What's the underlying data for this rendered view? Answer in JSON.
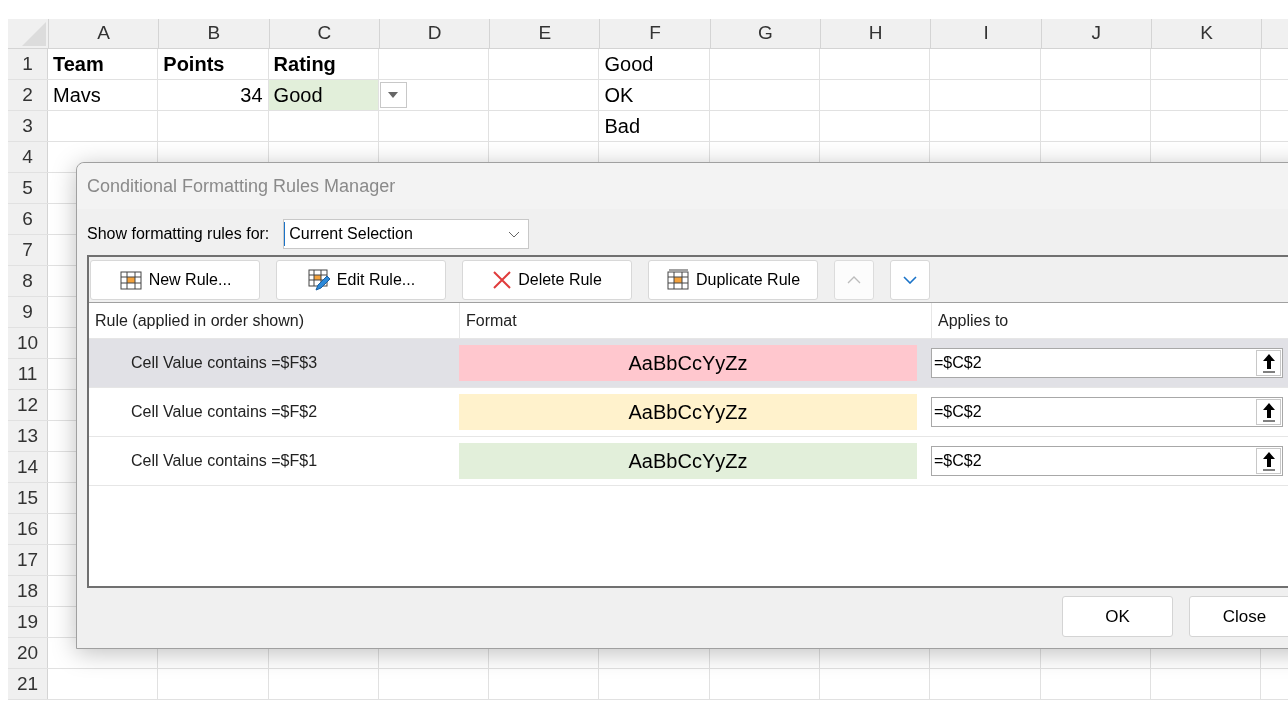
{
  "sheet": {
    "columns": [
      "A",
      "B",
      "C",
      "D",
      "E",
      "F",
      "G",
      "H",
      "I",
      "J",
      "K"
    ],
    "rows": [
      {
        "number": "1",
        "cells": [
          {
            "text": "Team",
            "bold": true,
            "kind": "text"
          },
          {
            "text": "Points",
            "bold": true,
            "kind": "text"
          },
          {
            "text": "Rating",
            "bold": true,
            "kind": "text"
          },
          null,
          null,
          {
            "text": "Good",
            "bold": false,
            "kind": "text"
          }
        ]
      },
      {
        "number": "2",
        "cells": [
          {
            "text": "Mavs",
            "bold": false,
            "kind": "text"
          },
          {
            "text": "34",
            "bold": false,
            "kind": "number"
          },
          {
            "text": "Good",
            "bold": false,
            "kind": "text",
            "color": "#e2efda",
            "dropdown": true
          },
          null,
          null,
          {
            "text": "OK",
            "bold": false,
            "kind": "text"
          }
        ]
      },
      {
        "number": "3",
        "cells": [
          null,
          null,
          null,
          null,
          null,
          {
            "text": "Bad",
            "bold": false,
            "kind": "text"
          }
        ]
      },
      {
        "number": "4"
      },
      {
        "number": "5"
      },
      {
        "number": "6"
      },
      {
        "number": "7"
      },
      {
        "number": "8"
      },
      {
        "number": "9"
      },
      {
        "number": "10"
      },
      {
        "number": "11"
      },
      {
        "number": "12"
      },
      {
        "number": "13"
      },
      {
        "number": "14"
      },
      {
        "number": "15"
      },
      {
        "number": "16"
      },
      {
        "number": "17"
      },
      {
        "number": "18"
      },
      {
        "number": "19"
      },
      {
        "number": "20"
      },
      {
        "number": "21"
      }
    ]
  },
  "dialog": {
    "title": "Conditional Formatting Rules Manager",
    "show_rules_label": "Show formatting rules for:",
    "show_rules_value": "Current Selection",
    "toolbar": [
      {
        "kind": "new",
        "label": "New Rule...",
        "disabled": false
      },
      {
        "kind": "edit",
        "label": "Edit Rule...",
        "disabled": false
      },
      {
        "kind": "delete",
        "label": "Delete Rule",
        "disabled": false
      },
      {
        "kind": "duplicate",
        "label": "Duplicate Rule",
        "disabled": false
      },
      {
        "kind": "up",
        "disabled": true
      },
      {
        "kind": "down",
        "disabled": false
      }
    ],
    "columns": [
      "Rule (applied in order shown)",
      "Format",
      "Applies to"
    ],
    "rules": [
      {
        "rule": "Cell Value contains =$F$3",
        "preview": "AaBbCcYyZz",
        "color": "#ffc7ce",
        "applies_to": "=$C$2",
        "selected": true
      },
      {
        "rule": "Cell Value contains =$F$2",
        "preview": "AaBbCcYyZz",
        "color": "#fff2cc",
        "applies_to": "=$C$2",
        "selected": false
      },
      {
        "rule": "Cell Value contains =$F$1",
        "preview": "AaBbCcYyZz",
        "color": "#e2efda",
        "applies_to": "=$C$2",
        "selected": false
      }
    ],
    "buttons": [
      "OK",
      "Close"
    ]
  }
}
